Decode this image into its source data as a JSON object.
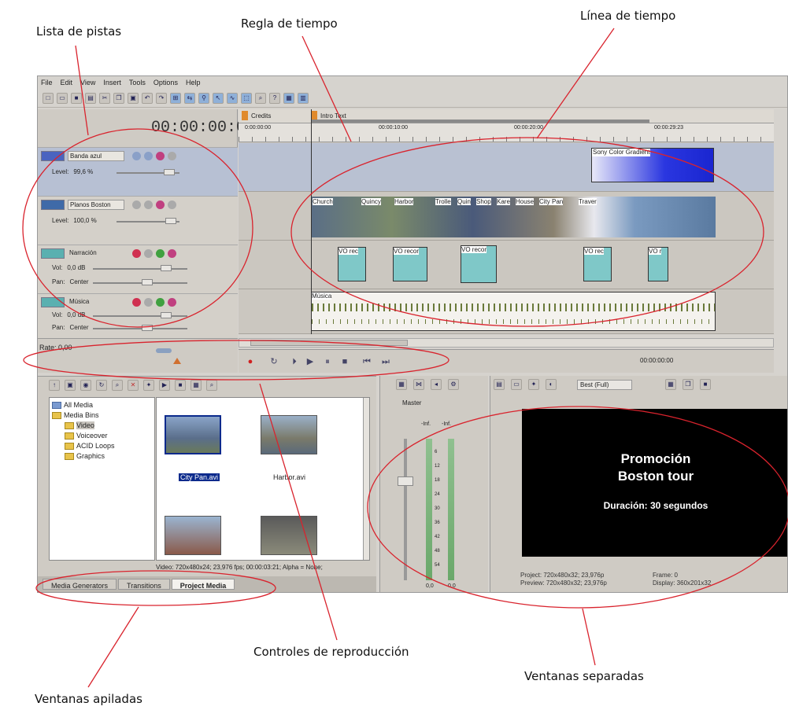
{
  "annotations": {
    "lista_pistas": "Lista de pistas",
    "regla_tiempo": "Regla de tiempo",
    "linea_tiempo": "Línea de tiempo",
    "controles_reproduccion": "Controles de reproducción",
    "ventanas_separadas": "Ventanas separadas",
    "ventanas_apiladas": "Ventanas apiladas"
  },
  "menu": [
    "File",
    "Edit",
    "View",
    "Insert",
    "Tools",
    "Options",
    "Help"
  ],
  "timecode": "00:00:00:00",
  "markers": {
    "credits": "Credits",
    "intro": "Intro Text"
  },
  "ruler_ticks": [
    "0:00:00:00",
    "00:00:10:00",
    "00:00:20:00",
    "00:00:29:23"
  ],
  "tracks": [
    {
      "name": "Banda azul",
      "param_label": "Level:",
      "param_value": "99,6 %"
    },
    {
      "name": "Planos Boston",
      "param_label": "Level:",
      "param_value": "100,0 %"
    },
    {
      "name": "Narración",
      "vol_label": "Vol:",
      "vol_value": "0,0 dB",
      "pan_label": "Pan:",
      "pan_value": "Center"
    },
    {
      "name": "Música",
      "vol_label": "Vol:",
      "vol_value": "0,0 dB",
      "pan_label": "Pan:",
      "pan_value": "Center"
    }
  ],
  "clips": {
    "gradient": "Sony Color Gradient",
    "video": [
      "Church",
      "Quincy",
      "Harbor",
      "Trolle",
      "Quin",
      "Shop",
      "Kare",
      "House",
      "City Pan",
      "Traver"
    ],
    "voice": [
      "VO rec",
      "VO recor",
      "VO recor",
      "VO rec",
      "VO r"
    ],
    "music": "Música"
  },
  "rate": "Rate: 0,00",
  "transport_timecode": "00:00:00:00",
  "tree": [
    {
      "label": "All Media",
      "level": 0
    },
    {
      "label": "Media Bins",
      "level": 0
    },
    {
      "label": "Video",
      "level": 1
    },
    {
      "label": "Voiceover",
      "level": 1
    },
    {
      "label": "ACID Loops",
      "level": 1
    },
    {
      "label": "Graphics",
      "level": 1
    }
  ],
  "media_files": {
    "file1": "City Pan.avi",
    "file2": "Harbor.avi"
  },
  "media_info": "Video: 720x480x24; 23,976 fps; 00:00:03:21; Alpha = None;",
  "tabs": [
    "Media Generators",
    "Transitions",
    "Project Media"
  ],
  "mixer": {
    "label": "Master",
    "inf_left": "-Inf.",
    "inf_right": "-Inf.",
    "scale": [
      "6",
      "12",
      "18",
      "24",
      "30",
      "36",
      "42",
      "48",
      "54"
    ],
    "bottom": "0,0"
  },
  "preview": {
    "quality": "Best (Full)",
    "title1": "Promoción",
    "title2": "Boston tour",
    "duration": "Duración: 30 segundos",
    "project": "Project:  720x480x32; 23,976p",
    "preview_info": "Preview:  720x480x32; 23,976p",
    "frame": "Frame:   0",
    "display": "Display:  360x201x32"
  },
  "colors": {
    "accent": "#d9232d",
    "window": "#d6d3ce",
    "selection": "#0b2a8c"
  }
}
